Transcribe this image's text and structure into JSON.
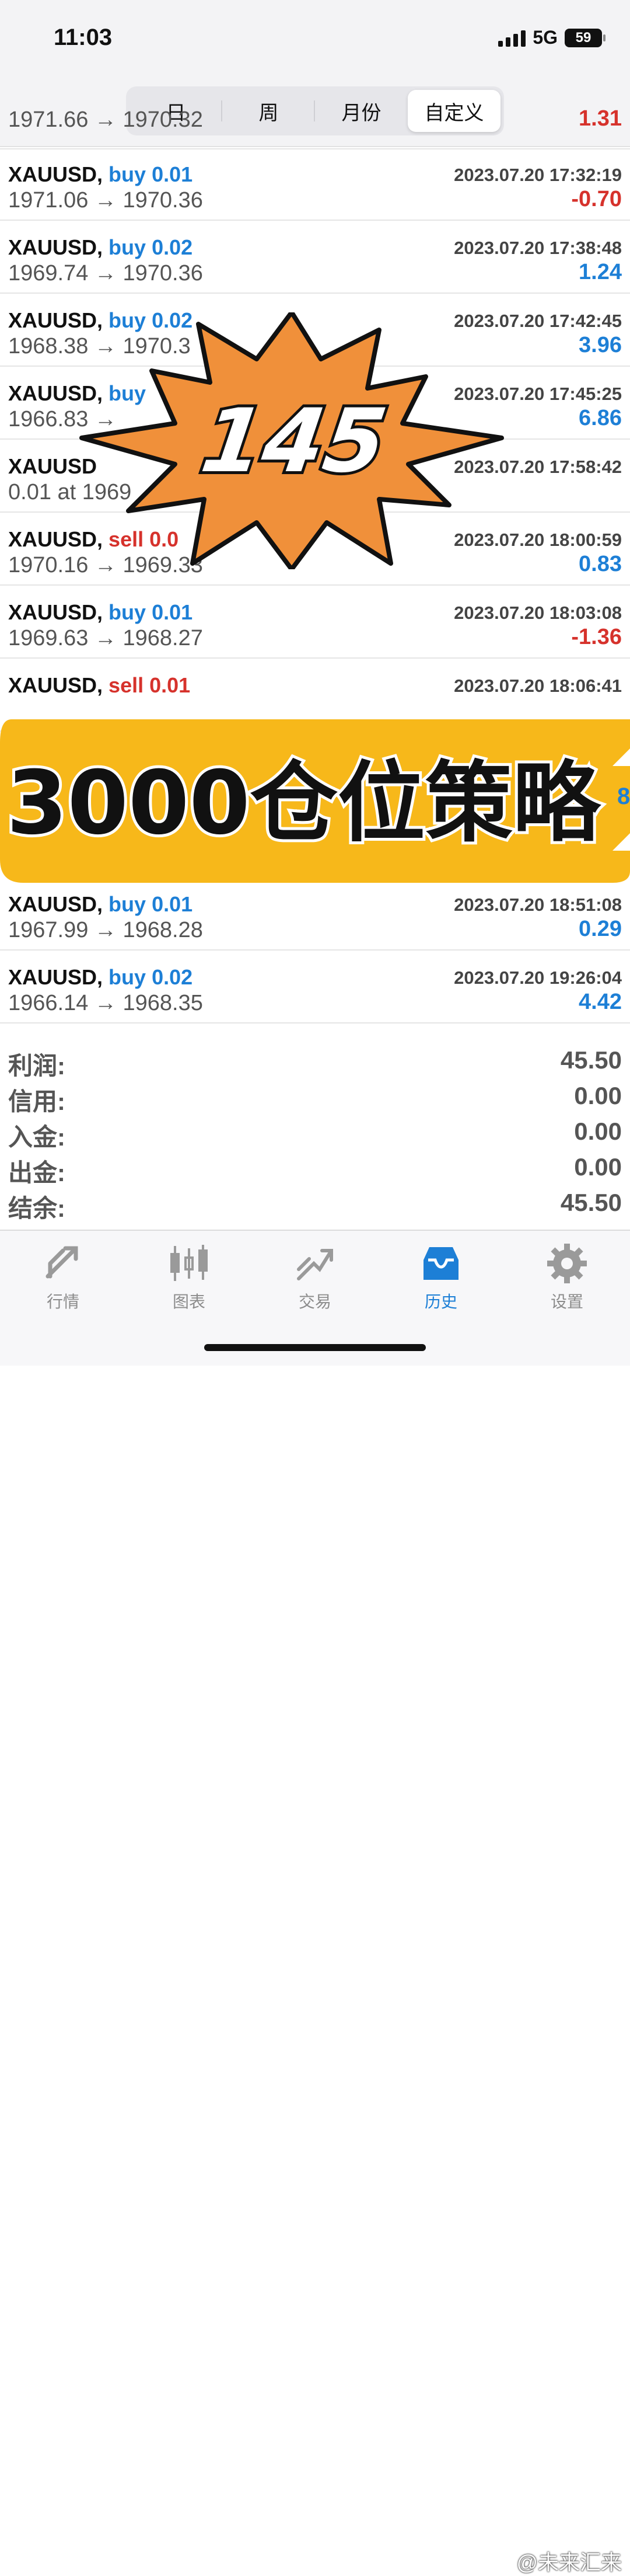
{
  "status": {
    "time": "11:03",
    "network": "5G",
    "battery": "59"
  },
  "period_tabs": [
    "日",
    "周",
    "月份",
    "自定义"
  ],
  "partial_row": {
    "price": "1971.66 → 1970.32",
    "profit": "1.31"
  },
  "trades": [
    {
      "symbol": "XAUUSD,",
      "side": "buy",
      "lots": "0.01",
      "time": "2023.07.20 17:32:19",
      "price": "1971.06 → 1970.36",
      "profit": "-0.70"
    },
    {
      "symbol": "XAUUSD,",
      "side": "buy",
      "lots": "0.02",
      "time": "2023.07.20 17:38:48",
      "price": "1969.74 → 1970.36",
      "profit": "1.24"
    },
    {
      "symbol": "XAUUSD,",
      "side": "buy",
      "lots": "0.02",
      "time": "2023.07.20 17:42:45",
      "price": "1968.38 → 1970.3",
      "profit": "3.96"
    },
    {
      "symbol": "XAUUSD,",
      "side": "buy",
      "lots": "",
      "time": "2023.07.20 17:45:25",
      "price": "1966.83 →",
      "profit": "6.86"
    },
    {
      "symbol": "XAUUSD",
      "side": "",
      "lots": "",
      "time": "2023.07.20 17:58:42",
      "price": "0.01 at 1969",
      "profit": ""
    },
    {
      "symbol": "XAUUSD,",
      "side": "sell",
      "lots": "0.0",
      "time": "2023.07.20 18:00:59",
      "price": "1970.16 → 1969.33",
      "profit": "0.83"
    },
    {
      "symbol": "XAUUSD,",
      "side": "buy",
      "lots": "0.01",
      "time": "2023.07.20 18:03:08",
      "price": "1969.63 → 1968.27",
      "profit": "-1.36"
    },
    {
      "symbol": "XAUUSD,",
      "side": "sell",
      "lots": "0.01",
      "time": "2023.07.20 18:06:41",
      "price": "",
      "profit": ""
    },
    {
      "symbol": "XAUUSD,",
      "side": "buy",
      "lots": "0.01",
      "time": "2023.07.20 18:51:08",
      "price": "1967.99 → 1968.28",
      "profit": "0.29"
    },
    {
      "symbol": "XAUUSD,",
      "side": "buy",
      "lots": "0.02",
      "time": "2023.07.20 19:26:04",
      "price": "1966.14 → 1968.35",
      "profit": "4.42"
    }
  ],
  "summary": [
    {
      "label": "利润:",
      "value": "45.50"
    },
    {
      "label": "信用:",
      "value": "0.00"
    },
    {
      "label": "入金:",
      "value": "0.00"
    },
    {
      "label": "出金:",
      "value": "0.00"
    },
    {
      "label": "结余:",
      "value": "45.50"
    }
  ],
  "overlays": {
    "badge_number": "145",
    "banner_text": "3000仓位策略",
    "banner_edge_digit": "8"
  },
  "bottom_tabs": [
    {
      "label": "行情",
      "icon": "quotes-icon"
    },
    {
      "label": "图表",
      "icon": "chart-icon"
    },
    {
      "label": "交易",
      "icon": "trade-icon"
    },
    {
      "label": "历史",
      "icon": "history-icon",
      "active": true
    },
    {
      "label": "设置",
      "icon": "settings-icon"
    }
  ],
  "watermark": "@未来汇来",
  "colors": {
    "buy": "#1d7fd6",
    "sell": "#d6322c",
    "badge": "#f0903a",
    "banner": "#f7b81a"
  }
}
